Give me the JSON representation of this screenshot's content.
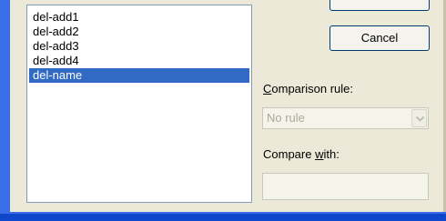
{
  "list": {
    "items": [
      "del-add1",
      "del-add2",
      "del-add3",
      "del-add4",
      "del-name"
    ],
    "selected_item": "del-name"
  },
  "buttons": {
    "cancel_label": "Cancel"
  },
  "comparison_rule": {
    "label_pre": "",
    "label_mnemonic": "C",
    "label_post": "omparison rule:",
    "selected_value": "No rule",
    "enabled": false
  },
  "compare_with": {
    "label_pre": "Compare ",
    "label_mnemonic": "w",
    "label_post": "ith:",
    "value": "",
    "enabled": false
  },
  "colors": {
    "dialog_bg": "#ece9d8",
    "selection_bg": "#316ac5",
    "selection_text": "#ffffff",
    "disabled_text": "#aca899",
    "window_frame": "#0e47cc"
  },
  "icons": {
    "dropdown_button": "chevron-down-icon"
  }
}
